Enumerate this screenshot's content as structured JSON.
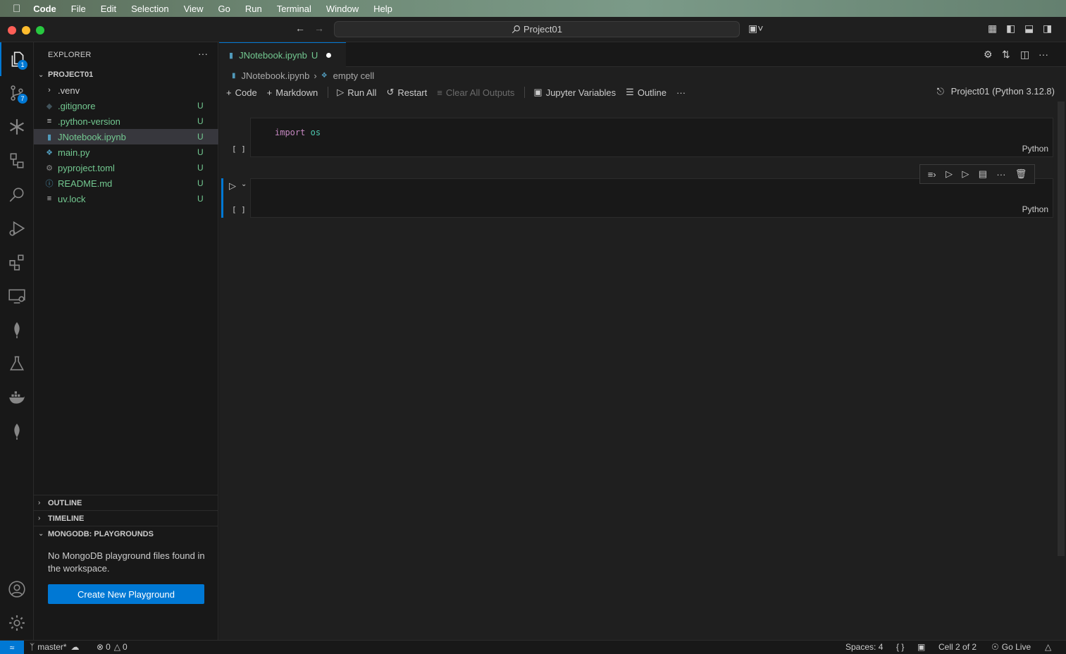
{
  "menubar": {
    "items": [
      "Code",
      "File",
      "Edit",
      "Selection",
      "View",
      "Go",
      "Run",
      "Terminal",
      "Window",
      "Help"
    ]
  },
  "titlebar": {
    "search_text": "Project01"
  },
  "activity_bar": {
    "explorer_badge": "1",
    "scm_badge": "7"
  },
  "sidebar": {
    "title": "EXPLORER",
    "project": "PROJECT01",
    "files": [
      {
        "name": ".venv",
        "status": ""
      },
      {
        "name": ".gitignore",
        "status": "U"
      },
      {
        "name": ".python-version",
        "status": "U"
      },
      {
        "name": "JNotebook.ipynb",
        "status": "U"
      },
      {
        "name": "main.py",
        "status": "U"
      },
      {
        "name": "pyproject.toml",
        "status": "U"
      },
      {
        "name": "README.md",
        "status": "U"
      },
      {
        "name": "uv.lock",
        "status": "U"
      }
    ],
    "outline": "OUTLINE",
    "timeline": "TIMELINE",
    "mongodb": "MONGODB: PLAYGROUNDS",
    "mongodb_message": "No MongoDB playground files found in the workspace.",
    "mongodb_button": "Create New Playground"
  },
  "editor": {
    "tab_label": "JNotebook.ipynb",
    "tab_status": "U",
    "breadcrumb": [
      "JNotebook.ipynb",
      "empty cell"
    ],
    "toolbar": {
      "code": "Code",
      "markdown": "Markdown",
      "run_all": "Run All",
      "restart": "Restart",
      "clear_outputs": "Clear All Outputs",
      "variables": "Jupyter Variables",
      "outline": "Outline"
    },
    "kernel": "Project01 (Python 3.12.8)",
    "cells": [
      {
        "keyword": "import",
        "module": "os",
        "lang": "Python",
        "brackets": "[ ]"
      },
      {
        "keyword": "",
        "module": "",
        "lang": "Python",
        "brackets": "[ ]"
      }
    ]
  },
  "statusbar": {
    "branch": "master*",
    "errors": "0",
    "warnings": "0",
    "spaces": "Spaces: 4",
    "braces": "{ }",
    "cell": "Cell 2 of 2",
    "golive": "Go Live"
  },
  "colors": {
    "accent": "#0078d4",
    "untracked": "#73c991",
    "keyword": "#c586c0",
    "module": "#4ec9b0"
  }
}
